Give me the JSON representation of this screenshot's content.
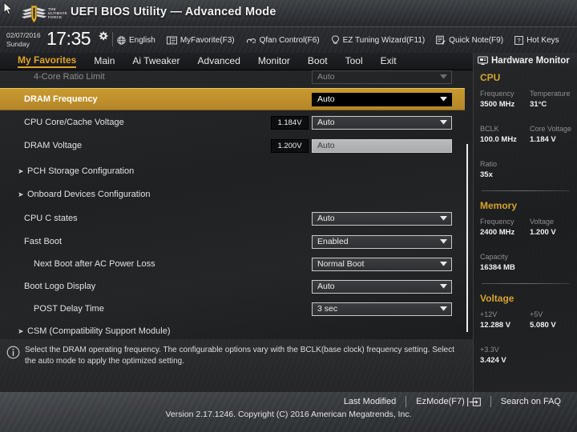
{
  "header": {
    "title": "UEFI BIOS Utility — Advanced Mode",
    "logo_icon": "tuf-ultimate-force-logo",
    "logo_text_1": "THE",
    "logo_text_2": "ULTIMATE",
    "logo_text_3": "FORCE",
    "cursor_icon": "mouse-pointer-icon"
  },
  "infobar": {
    "date": "02/07/2016",
    "weekday": "Sunday",
    "time": "17:35",
    "gear_icon": "gear-icon",
    "tools": [
      {
        "label": "English",
        "icon": "globe-icon"
      },
      {
        "label": "MyFavorite(F3)",
        "icon": "book-icon"
      },
      {
        "label": "Qfan Control(F6)",
        "icon": "fan-icon"
      },
      {
        "label": "EZ Tuning Wizard(F11)",
        "icon": "lightbulb-icon"
      },
      {
        "label": "Quick Note(F9)",
        "icon": "note-icon"
      },
      {
        "label": "Hot Keys",
        "icon": "question-box-icon"
      }
    ]
  },
  "nav": {
    "tabs": [
      {
        "label": "My Favorites",
        "active": true
      },
      {
        "label": "Main",
        "active": false
      },
      {
        "label": "Ai Tweaker",
        "active": false
      },
      {
        "label": "Advanced",
        "active": false
      },
      {
        "label": "Monitor",
        "active": false
      },
      {
        "label": "Boot",
        "active": false
      },
      {
        "label": "Tool",
        "active": false
      },
      {
        "label": "Exit",
        "active": false
      }
    ]
  },
  "settings": {
    "rows": [
      {
        "label": "4-Core Ratio Limit",
        "value": "Auto",
        "type": "ghost",
        "indent": 2,
        "highlight": false,
        "dim": true
      },
      {
        "label": "DRAM Frequency",
        "value": "Auto",
        "type": "dropdown",
        "indent": 1,
        "highlight": true,
        "dim": false
      },
      {
        "label": "CPU Core/Cache Voltage",
        "value": "Auto",
        "type": "dropdown",
        "indent": 1,
        "highlight": false,
        "dim": false,
        "readout": "1.184V"
      },
      {
        "label": "DRAM Voltage",
        "value": "Auto",
        "type": "flat",
        "indent": 1,
        "highlight": false,
        "dim": false,
        "readout": "1.200V"
      },
      {
        "label": "PCH Storage Configuration",
        "value": "",
        "type": "submenu",
        "indent": 0,
        "highlight": false,
        "dim": false
      },
      {
        "label": "Onboard Devices Configuration",
        "value": "",
        "type": "submenu",
        "indent": 0,
        "highlight": false,
        "dim": false
      },
      {
        "label": "CPU C states",
        "value": "Auto",
        "type": "dropdown",
        "indent": 1,
        "highlight": false,
        "dim": false
      },
      {
        "label": "Fast Boot",
        "value": "Enabled",
        "type": "dropdown",
        "indent": 1,
        "highlight": false,
        "dim": false
      },
      {
        "label": "Next Boot after AC Power Loss",
        "value": "Normal Boot",
        "type": "dropdown",
        "indent": 2,
        "highlight": false,
        "dim": false
      },
      {
        "label": "Boot Logo Display",
        "value": "Auto",
        "type": "dropdown",
        "indent": 1,
        "highlight": false,
        "dim": false
      },
      {
        "label": "POST Delay Time",
        "value": "3 sec",
        "type": "dropdown",
        "indent": 2,
        "highlight": false,
        "dim": false
      },
      {
        "label": "CSM (Compatibility Support Module)",
        "value": "",
        "type": "submenu",
        "indent": 0,
        "highlight": false,
        "dim": false
      }
    ],
    "scrollbar": "vertical-scrollbar"
  },
  "hardware_monitor": {
    "title": "Hardware Monitor",
    "title_icon": "monitor-icon",
    "sections": [
      {
        "name": "CPU",
        "entries": [
          {
            "key": "Frequency",
            "value": "3500 MHz"
          },
          {
            "key": "Temperature",
            "value": "31°C"
          },
          {
            "key": "BCLK",
            "value": "100.0 MHz"
          },
          {
            "key": "Core Voltage",
            "value": "1.184 V"
          },
          {
            "key": "Ratio",
            "value": "35x"
          }
        ]
      },
      {
        "name": "Memory",
        "entries": [
          {
            "key": "Frequency",
            "value": "2400 MHz"
          },
          {
            "key": "Voltage",
            "value": "1.200 V"
          },
          {
            "key": "Capacity",
            "value": "16384 MB"
          }
        ]
      },
      {
        "name": "Voltage",
        "entries": [
          {
            "key": "+12V",
            "value": "12.288 V"
          },
          {
            "key": "+5V",
            "value": "5.080 V"
          },
          {
            "key": "+3.3V",
            "value": "3.424 V"
          }
        ]
      }
    ]
  },
  "help": {
    "icon": "info-icon",
    "text": "Select the DRAM operating frequency. The configurable options vary with the BCLK(base clock) frequency setting. Select the auto mode to apply the optimized setting."
  },
  "footer": {
    "items": [
      {
        "label": "Last Modified",
        "icon": ""
      },
      {
        "label": "EzMode(F7)",
        "icon": "arrow-into-box-icon"
      },
      {
        "label": "Search on FAQ",
        "icon": ""
      }
    ],
    "version": "Version 2.17.1246. Copyright (C) 2016 American Megatrends, Inc."
  },
  "colors": {
    "accent": "#d8a32e",
    "highlight_row": "#c99a2e",
    "text": "#e8e8e8"
  }
}
